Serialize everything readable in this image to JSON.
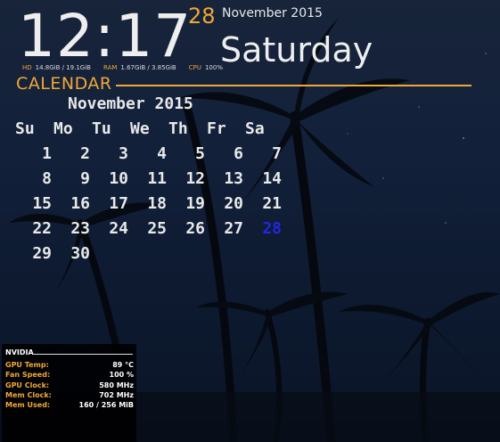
{
  "clock": {
    "time": "12:17",
    "day_number": "28",
    "month_year": "November 2015",
    "weekday": "Saturday"
  },
  "system_stats": [
    {
      "label": "HD",
      "value": "14.8GiB / 19.1GiB"
    },
    {
      "label": "RAM",
      "value": "1.67GiB / 3.85GiB"
    },
    {
      "label": "CPU",
      "value": "100%"
    }
  ],
  "calendar": {
    "title": "CALENDAR",
    "month_header": "November 2015",
    "weekdays": [
      "Su",
      "Mo",
      "Tu",
      "We",
      "Th",
      "Fr",
      "Sa"
    ],
    "weeks": [
      [
        "1",
        "2",
        "3",
        "4",
        "5",
        "6",
        "7"
      ],
      [
        "8",
        "9",
        "10",
        "11",
        "12",
        "13",
        "14"
      ],
      [
        "15",
        "16",
        "17",
        "18",
        "19",
        "20",
        "21"
      ],
      [
        "22",
        "23",
        "24",
        "25",
        "26",
        "27",
        "28"
      ],
      [
        "29",
        "30",
        "",
        "",
        "",
        "",
        ""
      ]
    ],
    "today": "28",
    "accent_color": "#f0a838",
    "today_color": "#2028e0"
  },
  "nvidia": {
    "title": "NVIDIA",
    "rows": [
      {
        "label": "GPU Temp:",
        "value": "89 °C"
      },
      {
        "label": "Fan Speed:",
        "value": "100 %"
      },
      {
        "label": "GPU Clock:",
        "value": "580 MHz"
      },
      {
        "label": "Mem Clock:",
        "value": "702 MHz"
      },
      {
        "label": "Mem Used:",
        "value": "160 / 256 MiB"
      }
    ]
  }
}
